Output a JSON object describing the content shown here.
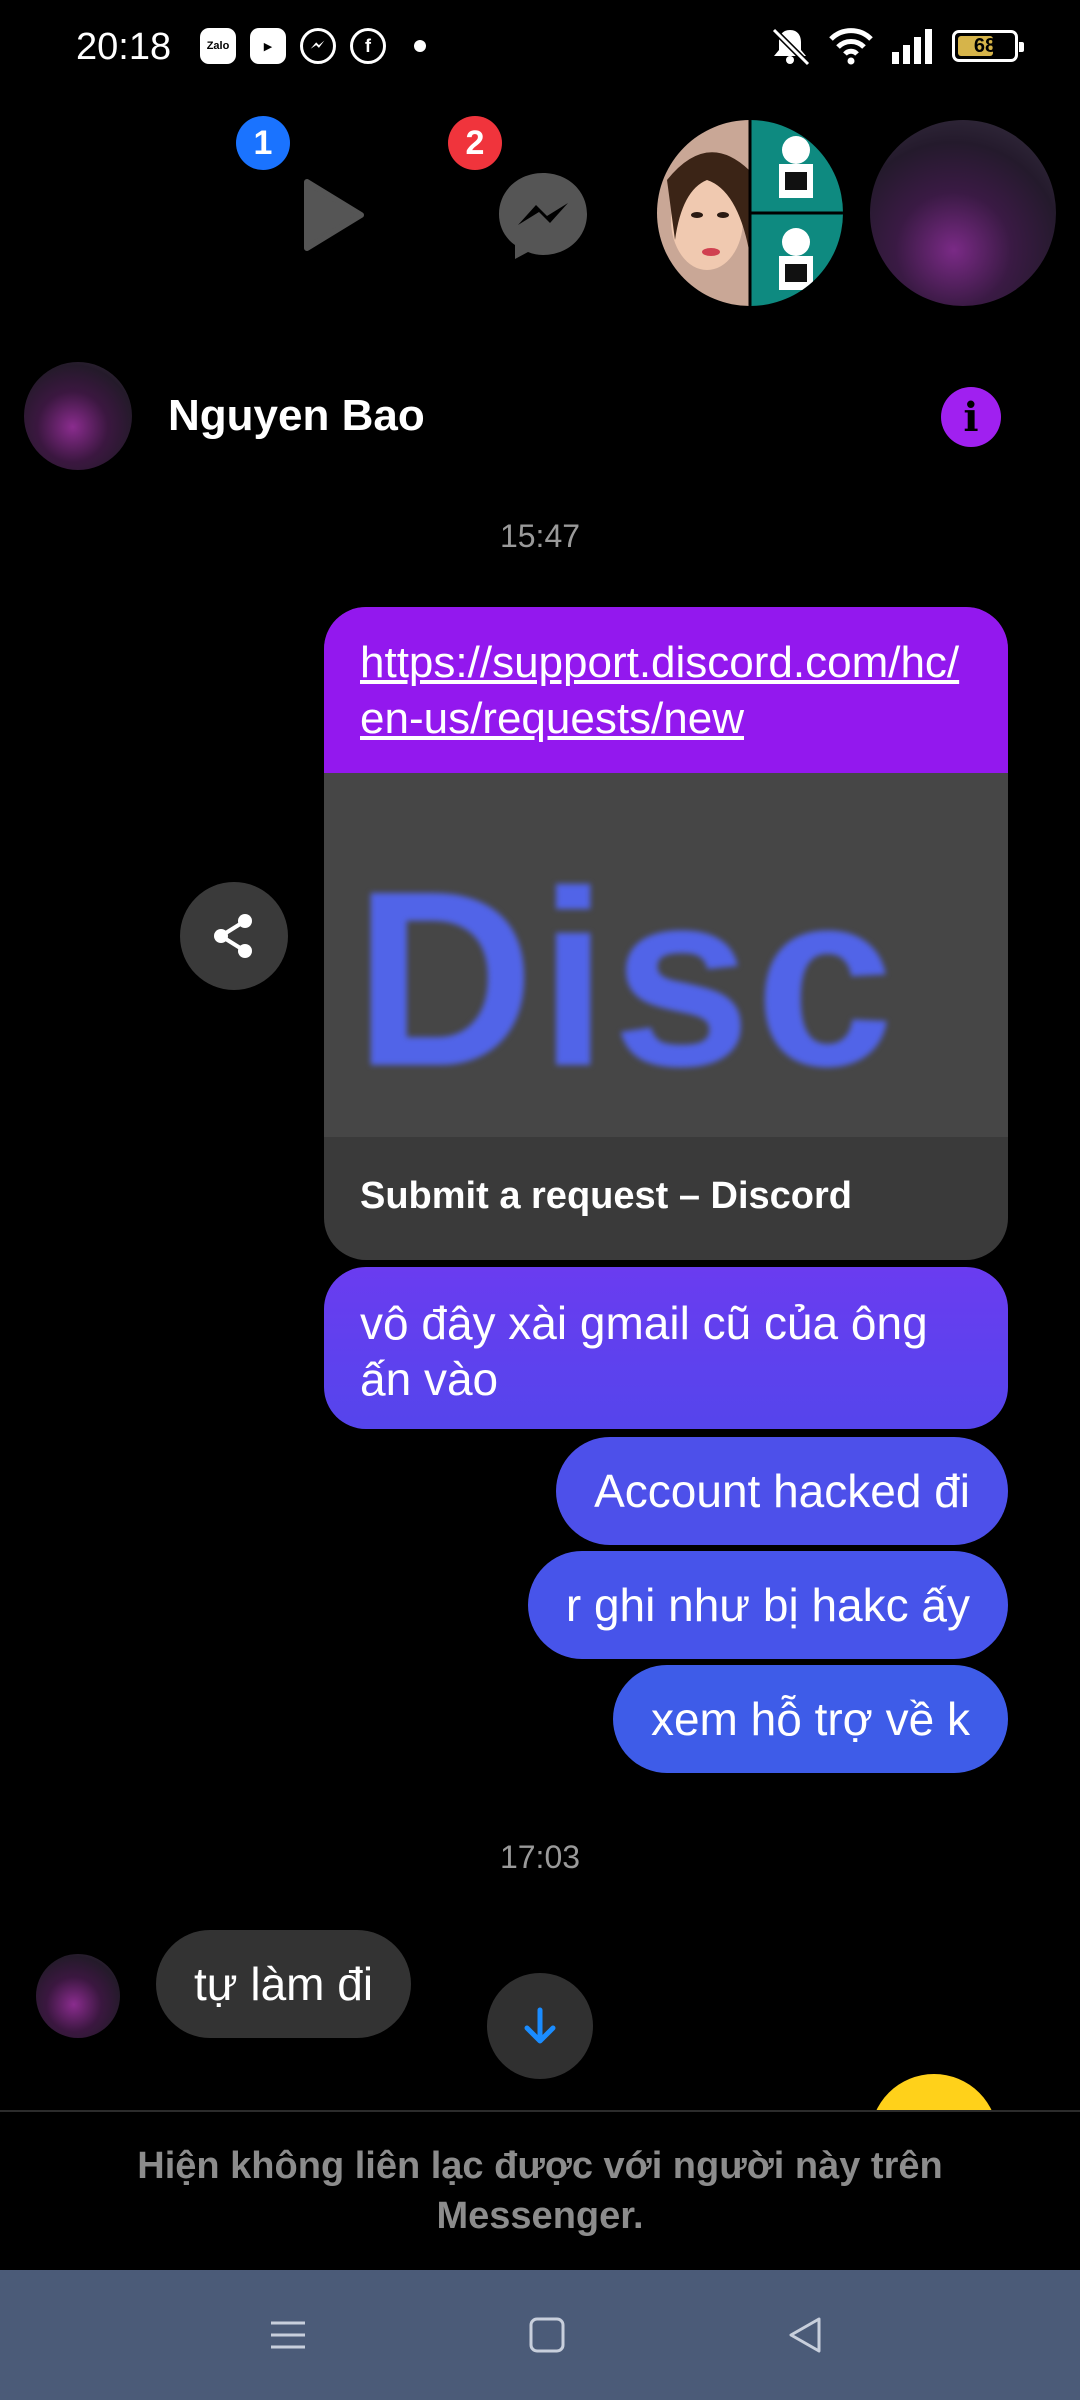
{
  "status_bar": {
    "time": "20:18",
    "battery": "68",
    "battery_level": 0.68,
    "app_icons": [
      "zalo-icon",
      "zalo-video-icon",
      "messenger-icon",
      "facebook-icon"
    ],
    "right_icons": [
      "mute-icon",
      "wifi-icon",
      "signal-icon",
      "battery-icon"
    ]
  },
  "chat_heads": {
    "play_badge": "1",
    "messenger_badge": "2",
    "badge_colors": [
      "#1a73ff",
      "#f0343c"
    ]
  },
  "header": {
    "name": "Nguyen Bao"
  },
  "timestamps": {
    "first": "15:47",
    "second": "17:03"
  },
  "link_card": {
    "url": "https://support.discord.com/hc/en-us/requests/new",
    "preview_text": "Disc",
    "title": "Submit a request – Discord"
  },
  "outgoing_messages": [
    {
      "text": "vô đây xài gmail cũ của ông ấn vào"
    },
    {
      "text": "Account hacked đi"
    },
    {
      "text": "r ghi như bị hakc ấy"
    },
    {
      "text": "xem hỗ trợ về k"
    }
  ],
  "incoming_message": {
    "text": "tự làm đi"
  },
  "notice": "Hiện không liên lạc được với người này trên Messenger.",
  "colors": {
    "accent": "#9318ee",
    "bubble_gradient_top": "#6a3cf0",
    "bubble_gradient_bottom": "#3d5ee8",
    "navbar": "#4b5b78"
  }
}
